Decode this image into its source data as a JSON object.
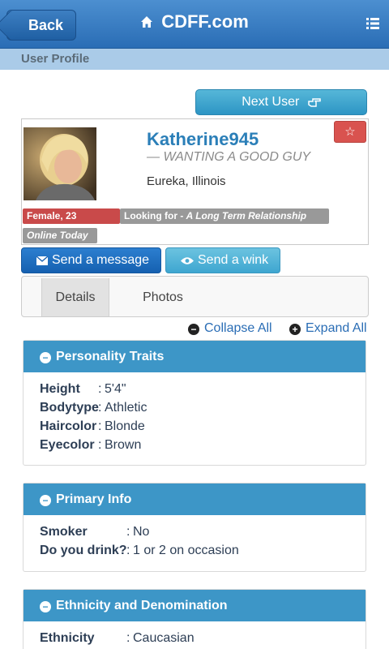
{
  "header": {
    "back_label": "Back",
    "brand": "CDFF.com"
  },
  "subheader": {
    "title": "User Profile"
  },
  "next_user": {
    "label": "Next User"
  },
  "profile": {
    "username": "Katherine945",
    "tagline": "— WANTING A GOOD GUY",
    "location": "Eureka, Illinois",
    "gender_age": "Female, 23",
    "looking_for_prefix": "Looking for - ",
    "looking_for_value": "A Long Term Relationship",
    "online_status": "Online Today"
  },
  "actions": {
    "message_label": "Send a message",
    "wink_label": "Send a wink"
  },
  "tabs": [
    {
      "label": "Details"
    },
    {
      "label": "Photos"
    }
  ],
  "controls": {
    "collapse_all": "Collapse All",
    "expand_all": "Expand All"
  },
  "sections": [
    {
      "title": "Personality Traits",
      "rows": [
        {
          "label": "Height",
          "value": "5'4\""
        },
        {
          "label": "Bodytype",
          "value": "Athletic"
        },
        {
          "label": "Haircolor",
          "value": "Blonde"
        },
        {
          "label": "Eyecolor",
          "value": "Brown"
        }
      ]
    },
    {
      "title": "Primary Info",
      "rows": [
        {
          "label": "Smoker",
          "value": "No"
        },
        {
          "label": "Do you drink?",
          "value": "1 or 2 on occasion"
        }
      ]
    },
    {
      "title": "Ethnicity and Denomination",
      "rows": [
        {
          "label": "Ethnicity",
          "value": "Caucasian"
        }
      ]
    }
  ],
  "colors": {
    "header_blue": "#2a6db5",
    "section_blue": "#3d96c7",
    "accent_red": "#d9534f",
    "link_blue": "#2a6db5"
  },
  "icons": [
    "home-icon",
    "menu-icon",
    "pointing-hand-icon",
    "star-icon",
    "envelope-icon",
    "eye-icon",
    "minus-circle-icon",
    "plus-circle-icon"
  ]
}
